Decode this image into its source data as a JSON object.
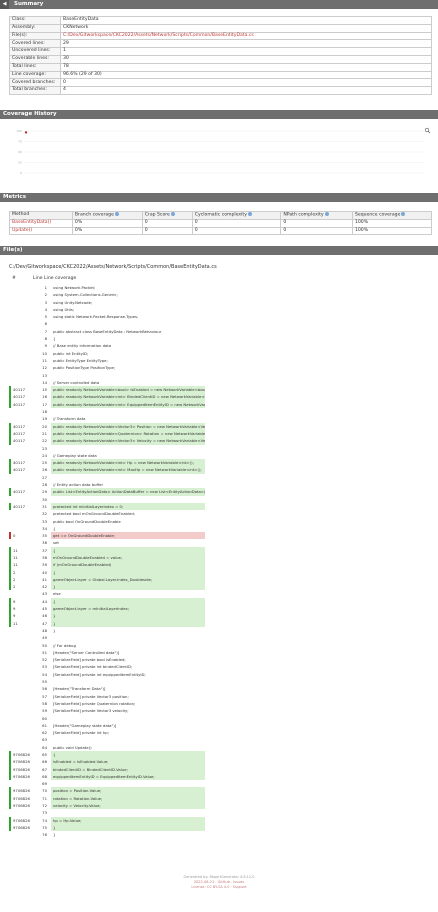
{
  "summary": {
    "section_title": "Summary",
    "collapse_glyph": "◀",
    "rows": [
      {
        "key": "Class:",
        "value": "BaseEntityData"
      },
      {
        "key": "Assembly:",
        "value": "CKNetwork"
      },
      {
        "key": "File(s):",
        "value": "C:/Dev/Gitworkspace/CKC2022/Assets/Network/Scripts/Common/BaseEntityData.cs",
        "link": true
      },
      {
        "key": "Covered lines:",
        "value": "29"
      },
      {
        "key": "Uncovered lines:",
        "value": "1"
      },
      {
        "key": "Coverable lines:",
        "value": "30"
      },
      {
        "key": "Total lines:",
        "value": "78"
      },
      {
        "key": "Line coverage:",
        "value": "96.6% (29 of 30)"
      },
      {
        "key": "Covered branches:",
        "value": "0"
      },
      {
        "key": "Total branches:",
        "value": "4"
      }
    ]
  },
  "history": {
    "section_title": "Coverage History",
    "y_labels": [
      "100",
      "75",
      "50",
      "25",
      "0"
    ],
    "zoom_icon": "magnifier-plus-icon"
  },
  "chart_data": {
    "type": "line",
    "title": "",
    "xlabel": "",
    "ylabel": "",
    "ylim": [
      0,
      100
    ],
    "series": [
      {
        "values": [
          96.6
        ]
      }
    ]
  },
  "metrics": {
    "section_title": "Metrics",
    "columns": [
      "Method",
      "Branch coverage",
      "Crap Score",
      "Cyclomatic complexity",
      "NPath complexity",
      "Sequence coverage"
    ],
    "rows": [
      [
        "BaseEntityData()",
        "0%",
        "0",
        "0",
        "0",
        "100%"
      ],
      [
        "Update()",
        "0%",
        "0",
        "0",
        "0",
        "100%"
      ]
    ]
  },
  "files": {
    "section_title": "File(s)",
    "path": "C:/Dev/Gitworkspace/CKC2022/Assets/Network/Scripts/Common/BaseEntityData.cs",
    "col_hash": "#",
    "col_line": "Line",
    "col_coverage": "Line coverage",
    "lines": [
      {
        "s": "n",
        "h": "",
        "t": "using Network.Packet;"
      },
      {
        "s": "n",
        "h": "",
        "t": "using System.Collections.Generic;"
      },
      {
        "s": "n",
        "h": "",
        "t": "using Unity.Netcode;"
      },
      {
        "s": "n",
        "h": "",
        "t": "using Utils;"
      },
      {
        "s": "n",
        "h": "",
        "t": "using static Network.Packet.Response.Types;"
      },
      {
        "s": "n",
        "h": "",
        "t": ""
      },
      {
        "s": "n",
        "h": "",
        "t": "public abstract class BaseEntityData : NetworkBehaviour"
      },
      {
        "s": "n",
        "h": "",
        "t": "{"
      },
      {
        "s": "n",
        "h": "",
        "t": "    // Base entity information data"
      },
      {
        "s": "n",
        "h": "",
        "t": "    public int EntityID;"
      },
      {
        "s": "n",
        "h": "",
        "t": "    public EntityType EntityType;"
      },
      {
        "s": "n",
        "h": "",
        "t": "    public PositionType PositionType;"
      },
      {
        "s": "n",
        "h": "",
        "t": ""
      },
      {
        "s": "n",
        "h": "",
        "t": "    // Server controlled data"
      },
      {
        "s": "c",
        "h": "40117",
        "t": "    public readonly NetworkVariable<bool> IsEnabled = new NetworkVariable<bool>();"
      },
      {
        "s": "c",
        "h": "40117",
        "t": "    public readonly NetworkVariable<int> BindedClientID = new NetworkVariable<int>();"
      },
      {
        "s": "c",
        "h": "40117",
        "t": "    public readonly NetworkVariable<int> EquippedItemEntityID = new NetworkVariable<int>();"
      },
      {
        "s": "n",
        "h": "",
        "t": ""
      },
      {
        "s": "n",
        "h": "",
        "t": "    // Transform data"
      },
      {
        "s": "c",
        "h": "40117",
        "t": "    public readonly NetworkVariable<Vector3> Position = new NetworkVariable<Vector3>();"
      },
      {
        "s": "c",
        "h": "40117",
        "t": "    public readonly NetworkVariable<Quaternion> Rotation = new NetworkVariable<Quaternion>();"
      },
      {
        "s": "c",
        "h": "40117",
        "t": "    public readonly NetworkVariable<Vector3> Velocity = new NetworkVariable<Vector3>();"
      },
      {
        "s": "n",
        "h": "",
        "t": ""
      },
      {
        "s": "n",
        "h": "",
        "t": "    // Gameplay state data"
      },
      {
        "s": "c",
        "h": "40117",
        "t": "    public readonly NetworkVariable<int> Hp = new NetworkVariable<int>();"
      },
      {
        "s": "c",
        "h": "40117",
        "t": "    public readonly NetworkVariable<int> MaxHp = new NetworkVariable<int>();"
      },
      {
        "s": "n",
        "h": "",
        "t": ""
      },
      {
        "s": "n",
        "h": "",
        "t": "    // Entity action data buffer"
      },
      {
        "s": "c",
        "h": "40117",
        "t": "    public List<EntityActionData> ActionDataBuffer = new List<EntityActionData>(8);"
      },
      {
        "s": "n",
        "h": "",
        "t": ""
      },
      {
        "s": "c",
        "h": "40117",
        "t": "    protected int mInitialLayerIndex = 0;"
      },
      {
        "s": "n",
        "h": "",
        "t": "    protected bool mOnGroundDoubleEnabled;"
      },
      {
        "s": "n",
        "h": "",
        "t": "    public bool OnGroundDoubleEnable"
      },
      {
        "s": "n",
        "h": "",
        "t": "    {"
      },
      {
        "s": "u",
        "h": "0",
        "t": "        get => OnGroundDoubleEnable;"
      },
      {
        "s": "n",
        "h": "",
        "t": "        set"
      },
      {
        "s": "c",
        "h": "11",
        "t": "        {"
      },
      {
        "s": "c",
        "h": "11",
        "t": "            mOnGroundDoubleEnabled = value;"
      },
      {
        "s": "c",
        "h": "11",
        "t": "            if (mOnGroundDoubleEnabled)"
      },
      {
        "s": "c",
        "h": "2",
        "t": "            {"
      },
      {
        "s": "c",
        "h": "2",
        "t": "                gameObject.layer = Global.Layer.Index_Doubleside;"
      },
      {
        "s": "c",
        "h": "2",
        "t": "            }"
      },
      {
        "s": "n",
        "h": "",
        "t": "            else"
      },
      {
        "s": "c",
        "h": "9",
        "t": "            {"
      },
      {
        "s": "c",
        "h": "9",
        "t": "                gameObject.layer = mInitialLayerIndex;"
      },
      {
        "s": "c",
        "h": "9",
        "t": "            }"
      },
      {
        "s": "c",
        "h": "11",
        "t": "        }"
      },
      {
        "s": "n",
        "h": "",
        "t": "    }"
      },
      {
        "s": "n",
        "h": "",
        "t": ""
      },
      {
        "s": "n",
        "h": "",
        "t": "    // For debug"
      },
      {
        "s": "n",
        "h": "",
        "t": "    [Header(\"Server Controlled data\")]"
      },
      {
        "s": "n",
        "h": "",
        "t": "    [SerializeField] private bool isEnabled;"
      },
      {
        "s": "n",
        "h": "",
        "t": "    [SerializeField] private int bindedClientID;"
      },
      {
        "s": "n",
        "h": "",
        "t": "    [SerializeField] private int equippedItemEntityID;"
      },
      {
        "s": "n",
        "h": "",
        "t": ""
      },
      {
        "s": "n",
        "h": "",
        "t": "    [Header(\"Transform Data\")]"
      },
      {
        "s": "n",
        "h": "",
        "t": "    [SerializeField] private Vector3 position;"
      },
      {
        "s": "n",
        "h": "",
        "t": "    [SerializeField] private Quaternion rotation;"
      },
      {
        "s": "n",
        "h": "",
        "t": "    [SerializeField] private Vector3 velocity;"
      },
      {
        "s": "n",
        "h": "",
        "t": ""
      },
      {
        "s": "n",
        "h": "",
        "t": "    [Header(\"Gameplay state data\")]"
      },
      {
        "s": "n",
        "h": "",
        "t": "    [SerializeField] private int hp;"
      },
      {
        "s": "n",
        "h": "",
        "t": ""
      },
      {
        "s": "n",
        "h": "",
        "t": "    public void Update()"
      },
      {
        "s": "c",
        "h": "9706826",
        "t": "    {"
      },
      {
        "s": "c",
        "h": "9706826",
        "t": "        isEnabled = IsEnabled.Value;"
      },
      {
        "s": "c",
        "h": "9706826",
        "t": "        bindedClientID = BindedClientID.Value;"
      },
      {
        "s": "c",
        "h": "9706826",
        "t": "        equippedItemEntityID = EquippedItemEntityID.Value;"
      },
      {
        "s": "n",
        "h": "",
        "t": ""
      },
      {
        "s": "c",
        "h": "9706826",
        "t": "        position = Position.Value;"
      },
      {
        "s": "c",
        "h": "9706826",
        "t": "        rotation = Rotation.Value;"
      },
      {
        "s": "c",
        "h": "9706826",
        "t": "        velocity = Velocity.Value;"
      },
      {
        "s": "n",
        "h": "",
        "t": ""
      },
      {
        "s": "c",
        "h": "9706826",
        "t": "        hp = Hp.Value;"
      },
      {
        "s": "c",
        "h": "9706826",
        "t": "    }"
      },
      {
        "s": "n",
        "h": "",
        "t": "}"
      }
    ]
  },
  "footer": {
    "line1": "Generated by: ReportGenerator 4.8.12.0",
    "line2": "2022-08-21 - GitHub - Issues",
    "line3": "License: CC BY-SA 4.0 · Support"
  }
}
